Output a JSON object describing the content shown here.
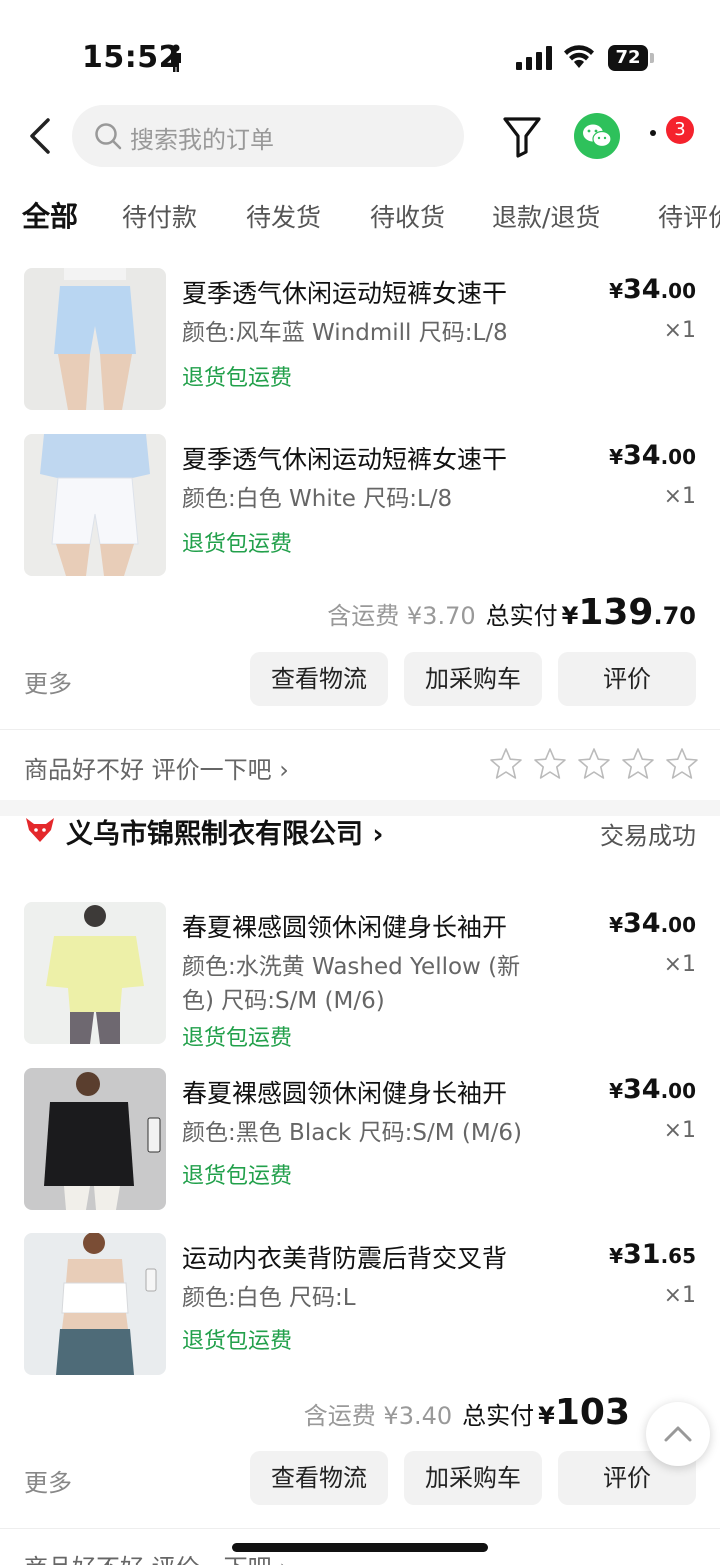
{
  "status_bar": {
    "time": "15:52",
    "battery": "72"
  },
  "header": {
    "search_placeholder": "搜索我的订单",
    "badge_count": "3"
  },
  "tabs": [
    {
      "label": "全部",
      "active": true
    },
    {
      "label": "待付款"
    },
    {
      "label": "待发货"
    },
    {
      "label": "待收货"
    },
    {
      "label": "退款/退货"
    },
    {
      "label": "待评价"
    }
  ],
  "order1": {
    "items": [
      {
        "title": "夏季透气休闲运动短裤女速干",
        "spec": "颜色:风车蓝 Windmill 尺码:L/8",
        "tag": "退货包运费",
        "price_int": "34",
        "price_dec": ".00",
        "qty": "×1",
        "thumb_color": "#bcd8f2"
      },
      {
        "title": "夏季透气休闲运动短裤女速干",
        "spec": "颜色:白色 White 尺码:L/8",
        "tag": "退货包运费",
        "price_int": "34",
        "price_dec": ".00",
        "qty": "×1",
        "thumb_color": "#eef1f7"
      }
    ],
    "freight": "含运费 ¥3.70",
    "total_label": "总实付",
    "total_int": "139",
    "total_dec": ".70",
    "more": "更多",
    "buttons": {
      "logistics": "查看物流",
      "cart": "加采购车",
      "review": "评价"
    },
    "rate_prompt": "商品好不好 评价一下吧"
  },
  "order2": {
    "shop_name": "义乌市锦熙制衣有限公司",
    "status": "交易成功",
    "items": [
      {
        "title": "春夏裸感圆领休闲健身长袖开",
        "spec": "颜色:水洗黄 Washed Yellow (新色) 尺码:S/M (M/6)",
        "tag": "退货包运费",
        "price_int": "34",
        "price_dec": ".00",
        "qty": "×1",
        "thumb_color": "#eef0b8"
      },
      {
        "title": "春夏裸感圆领休闲健身长袖开",
        "spec": "颜色:黑色 Black 尺码:S/M (M/6)",
        "tag": "退货包运费",
        "price_int": "34",
        "price_dec": ".00",
        "qty": "×1",
        "thumb_color": "#cfcfd0"
      },
      {
        "title": "运动内衣美背防震后背交叉背",
        "spec": "颜色:白色 尺码:L",
        "tag": "退货包运费",
        "price_int": "31",
        "price_dec": ".65",
        "qty": "×1",
        "thumb_color": "#e4e8ea"
      }
    ],
    "freight": "含运费 ¥3.40",
    "total_label": "总实付",
    "total_int": "103",
    "more": "更多",
    "buttons": {
      "logistics": "查看物流",
      "cart": "加采购车",
      "review": "评价"
    },
    "rate_prompt": "商品好不好 评价一下吧"
  },
  "icons": {
    "back": "chevron-left-icon",
    "search": "search-icon",
    "filter": "filter-icon",
    "wechat": "wechat-icon",
    "more": "more-icon",
    "star": "star-icon",
    "scroll_top": "chevron-up-icon"
  },
  "colors": {
    "green_tag": "#22a04b",
    "badge_red": "#f5222d",
    "wechat_green": "#2ec15b",
    "shop_logo_red": "#e4282b"
  }
}
